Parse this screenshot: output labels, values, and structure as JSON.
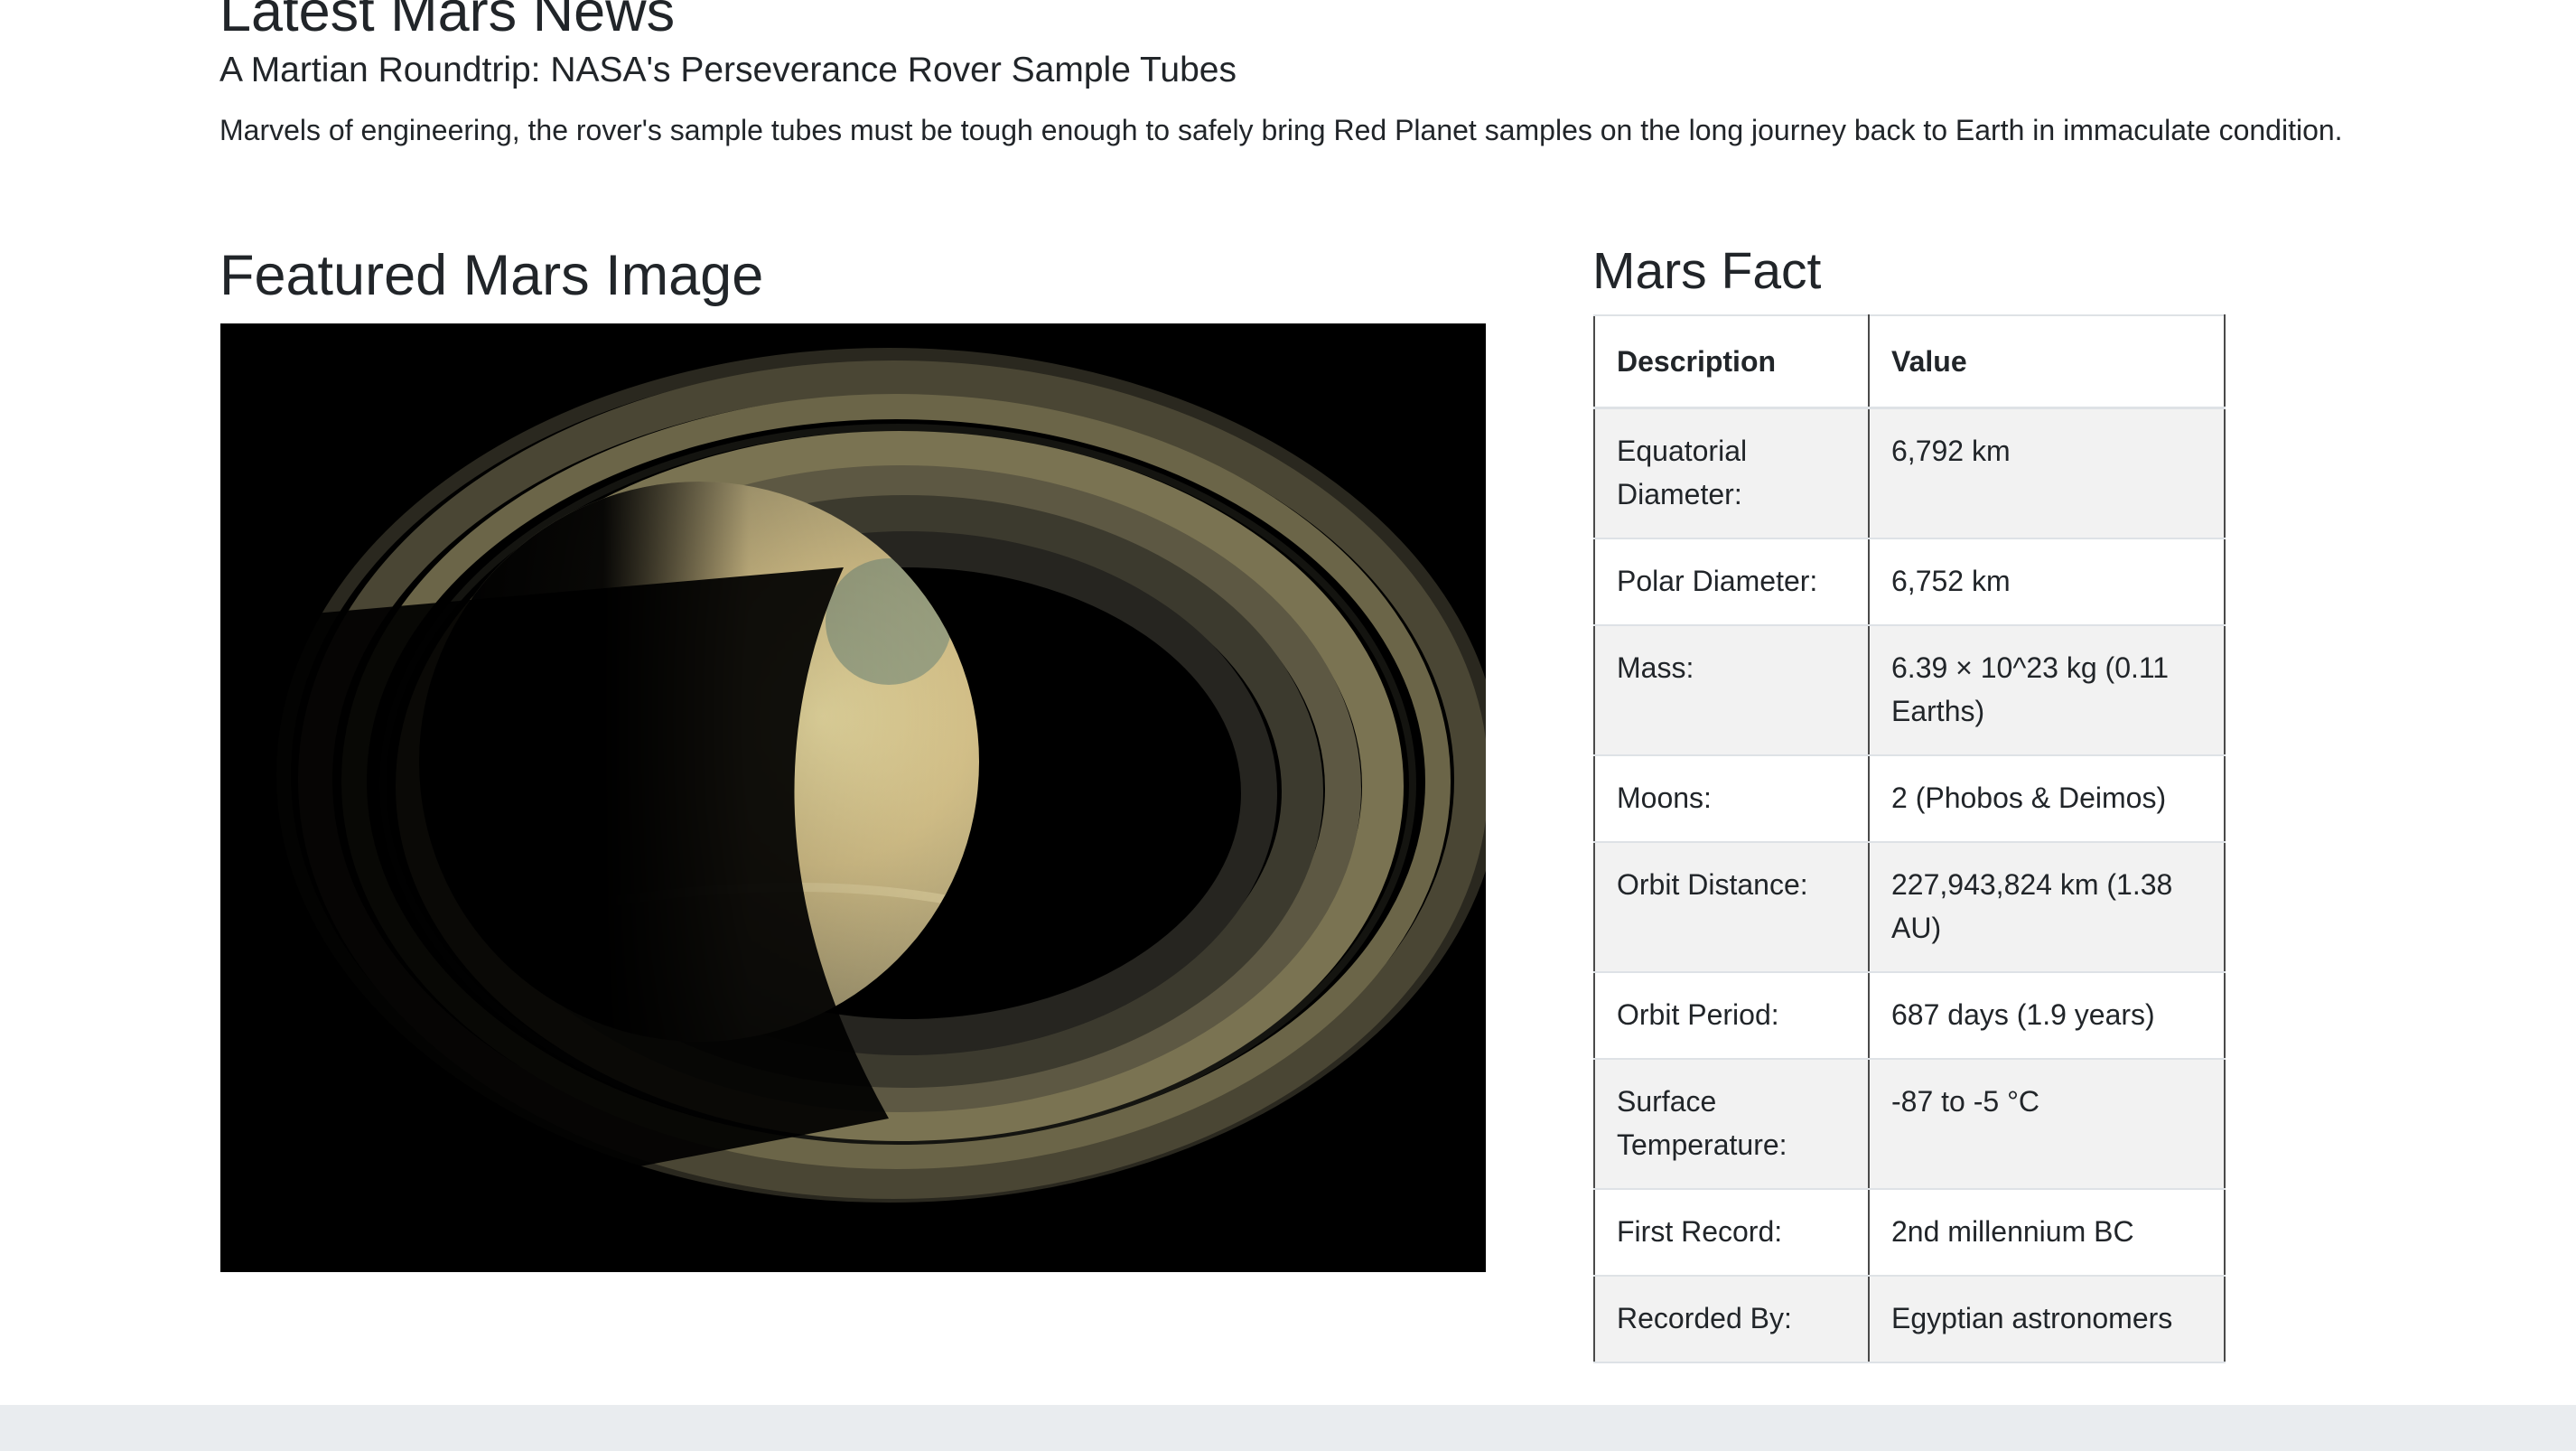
{
  "news": {
    "heading": "Latest Mars News",
    "title": "A Martian Roundtrip: NASA's Perseverance Rover Sample Tubes",
    "teaser": "Marvels of engineering, the rover's sample tubes must be tough enough to safely bring Red Planet samples on the long journey back to Earth in immaculate condition."
  },
  "featured_image": {
    "heading": "Featured Mars Image",
    "subject": "saturn-planet-image"
  },
  "mars_facts": {
    "heading": "Mars Fact",
    "columns": [
      "Description",
      "Value"
    ],
    "rows": [
      {
        "description": "Equatorial Diameter:",
        "value": "6,792 km"
      },
      {
        "description": "Polar Diameter:",
        "value": "6,752 km"
      },
      {
        "description": "Mass:",
        "value": "6.39 × 10^23 kg (0.11 Earths)"
      },
      {
        "description": "Moons:",
        "value": "2 (Phobos & Deimos)"
      },
      {
        "description": "Orbit Distance:",
        "value": "227,943,824 km (1.38 AU)"
      },
      {
        "description": "Orbit Period:",
        "value": "687 days (1.9 years)"
      },
      {
        "description": "Surface Temperature:",
        "value": "-87 to -5 °C"
      },
      {
        "description": "First Record:",
        "value": "2nd millennium BC"
      },
      {
        "description": "Recorded By:",
        "value": "Egyptian astronomers"
      }
    ]
  },
  "colors": {
    "text": "#212529",
    "table_stripe": "#f2f2f2",
    "footer": "#e9ecef",
    "image_background": "#000000"
  }
}
